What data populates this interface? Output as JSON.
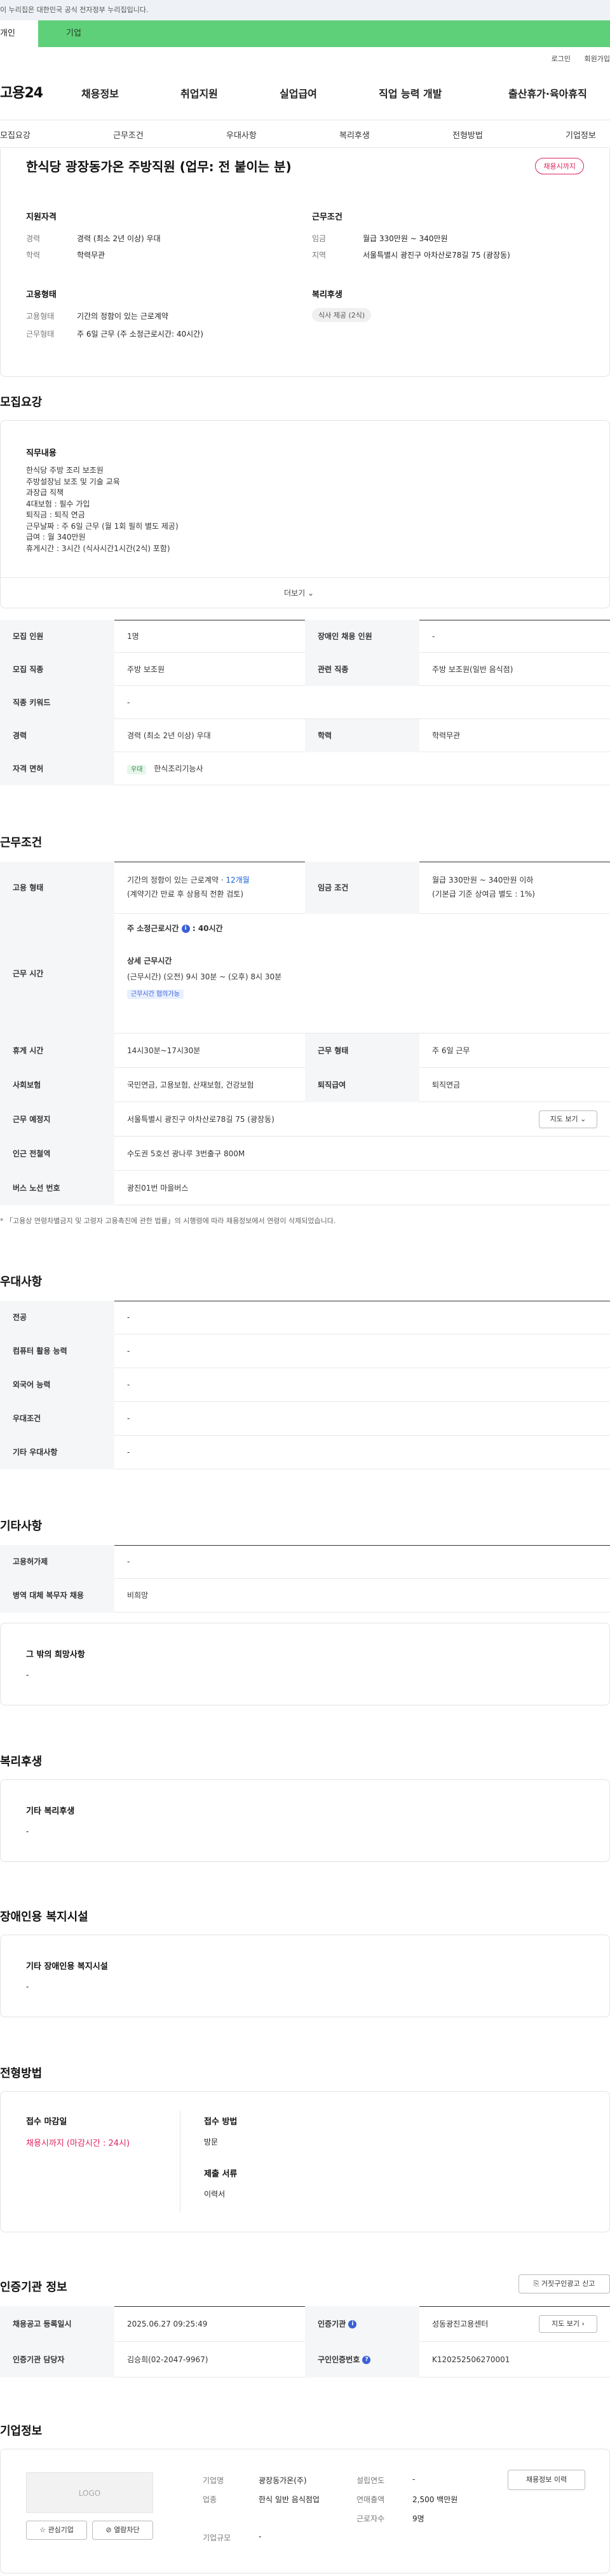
{
  "top": {
    "gov_notice": "이 누리집은 대한민국 공식 전자정부 누리집입니다.",
    "tab_personal": "개인",
    "tab_company": "기업",
    "login": "로그인",
    "join": "회원가입"
  },
  "gnb": {
    "logo": "고용24",
    "items": [
      "채용정보",
      "취업지원",
      "실업급여",
      "직업 능력 개발",
      "출산휴가·육아휴직"
    ]
  },
  "subnav": [
    "모집요강",
    "근무조건",
    "우대사항",
    "복리후생",
    "전형방법",
    "기업정보"
  ],
  "summary": {
    "title": "한식당 광장동가온 주방직원 (업무: 전 붙이는 분)",
    "status": "채용시까지",
    "qual_title": "지원자격",
    "qual_career_label": "경력",
    "qual_career_value": "경력 (최소 2년 이상) 우대",
    "qual_edu_label": "학력",
    "qual_edu_value": "학력무관",
    "cond_title": "근무조건",
    "cond_pay_label": "임금",
    "cond_pay_value": "월급 330만원 ~ 340만원",
    "cond_area_label": "지역",
    "cond_area_value": "서울특별시 광진구 아차산로78길 75 (광장동)",
    "emp_title": "고용형태",
    "emp_type_label": "고용형태",
    "emp_type_value": "기간의 정함이 있는 근로계약",
    "emp_work_label": "근무형태",
    "emp_work_value": "주 6일 근무 (주 소정근로시간: 40시간)",
    "welfare_title": "복리후생",
    "welfare_chip": "식사 제공 (2식)"
  },
  "recruit": {
    "title": "모집요강",
    "duty_label": "직무내용",
    "duty_lines": [
      "한식당 주방 조리 보조원",
      "주방설장님 보조 및 기술 교육",
      "과장급 직책",
      "4대보험 : 필수 가입",
      "퇴직금 : 퇴직 연금",
      "근무날짜 : 주 6일 근무 (월 1회 필히 별도 제공)",
      "급여 : 월 340만원",
      "휴게시간 : 3시간 (식사시간1시간(2식) 포함)"
    ],
    "more": "더보기",
    "rows": [
      {
        "th1": "모집 인원",
        "td1": "1명",
        "th2": "장애인 채용 인원",
        "td2": "-"
      },
      {
        "th1": "모집 직종",
        "td1": "주방 보조원",
        "th2": "관련 직종",
        "td2": "주방 보조원(일반 음식점)"
      },
      {
        "th1": "직종 키워드",
        "td1": "-"
      },
      {
        "th1": "경력",
        "td1": "경력 (최소 2년 이상) 우대",
        "th2": "학력",
        "td2": "학력무관"
      },
      {
        "th1": "자격 면허",
        "chip": "우대",
        "td1": "한식조리기능사"
      }
    ]
  },
  "work": {
    "title": "근무조건",
    "emp_label": "고용 형태",
    "emp_line1_prefix": "기간의 정함이 있는 근로계약 · ",
    "emp_line1_months": "12개월",
    "emp_line2": "(계약기간 만료 후 상용직 전환 검토)",
    "pay_label": "임금 조건",
    "pay_line1": "월급 330만원 ~ 340만원 이하",
    "pay_line2": "(기본급 기준 상여금 별도 : 1%)",
    "hours_label": "근무 시간",
    "hours_weekly_prefix": "주 소정근로시간",
    "hours_weekly_value": ": 40시간",
    "hours_detail_label": "상세 근무시간",
    "hours_detail_value": "(근무시간) (오전) 9시 30분 ~ (오후) 8시 30분",
    "hours_chip": "근무시간 협의가능",
    "rows": [
      {
        "th1": "휴게 시간",
        "td1": "14시30분~17시30분",
        "th2": "근무 형태",
        "td2": "주 6일 근무"
      },
      {
        "th1": "사회보험",
        "td1": "국민연금, 고용보험, 산재보험, 건강보험",
        "th2": "퇴직급여",
        "td2": "퇴직연금"
      },
      {
        "th1": "근무 예정지",
        "td1": "서울특별시 광진구 아차산로78길 75 (광장동)"
      },
      {
        "th1": "인근 전철역",
        "td1": "수도권 5호선 광나루 3번출구 800M"
      },
      {
        "th1": "버스 노선 번호",
        "td1": "광진01번 마을버스"
      }
    ],
    "map_btn": "지도 보기",
    "note": "* 「고용상 연령차별금지 및 고령자 고용촉진에 관한 법률」의 시행령에 따라 채용정보에서 연령이 삭제되었습니다."
  },
  "prefer": {
    "title": "우대사항",
    "rows": [
      {
        "th": "전공",
        "td": "-"
      },
      {
        "th": "컴퓨터 활용 능력",
        "td": "-"
      },
      {
        "th": "외국어 능력",
        "td": "-"
      },
      {
        "th": "우대조건",
        "td": "-"
      },
      {
        "th": "기타 우대사항",
        "td": "-"
      }
    ]
  },
  "etc": {
    "title": "기타사항",
    "rows": [
      {
        "th": "고용허가제",
        "td": "-"
      },
      {
        "th": "병역 대체 복무자 채용",
        "td": "비희망"
      }
    ],
    "box_label": "그 밖의 희망사항",
    "box_value": "-"
  },
  "welfare": {
    "title": "복리후생",
    "box_label": "기타 복리후생",
    "box_value": "-"
  },
  "disabled": {
    "title": "장애인용 복지시설",
    "box_label": "기타 장애인용 복지시설",
    "box_value": "-"
  },
  "selection": {
    "title": "전형방법",
    "deadline_label": "접수 마감일",
    "deadline_value": "채용시까지 (마감시간 : 24시)",
    "method_label": "접수 방법",
    "method_value": "방문",
    "docs_label": "제출 서류",
    "docs_value": "이력서"
  },
  "cert": {
    "title": "인증기관 정보",
    "fake_btn": "거짓구인광고 신고",
    "rows": [
      {
        "th1": "채용공고 등록일시",
        "td1": "2025.06.27 09:25:49",
        "th2": "인증기관",
        "td2": "성동광진고용센터"
      },
      {
        "th1": "인증기관 담당자",
        "td1": "김승희(02-2047-9967)",
        "th2": "구인인증번호",
        "td2": "K120252506270001"
      }
    ],
    "map_btn": "지도 보기"
  },
  "company": {
    "title": "기업정보",
    "logo": "LOGO",
    "fav_btn": "관심기업",
    "block_btn": "열람차단",
    "name_label": "기업명",
    "name_value": "광장동가온(주)",
    "industry_label": "업종",
    "industry_value": "한식 일반 음식점업",
    "size_label": "기업규모",
    "size_value": "-",
    "founded_label": "설립연도",
    "founded_value": "-",
    "sales_label": "연매출액",
    "sales_value": "2,500 백만원",
    "staff_label": "근로자수",
    "staff_value": "9명",
    "history_btn": "채용정보 이력"
  }
}
